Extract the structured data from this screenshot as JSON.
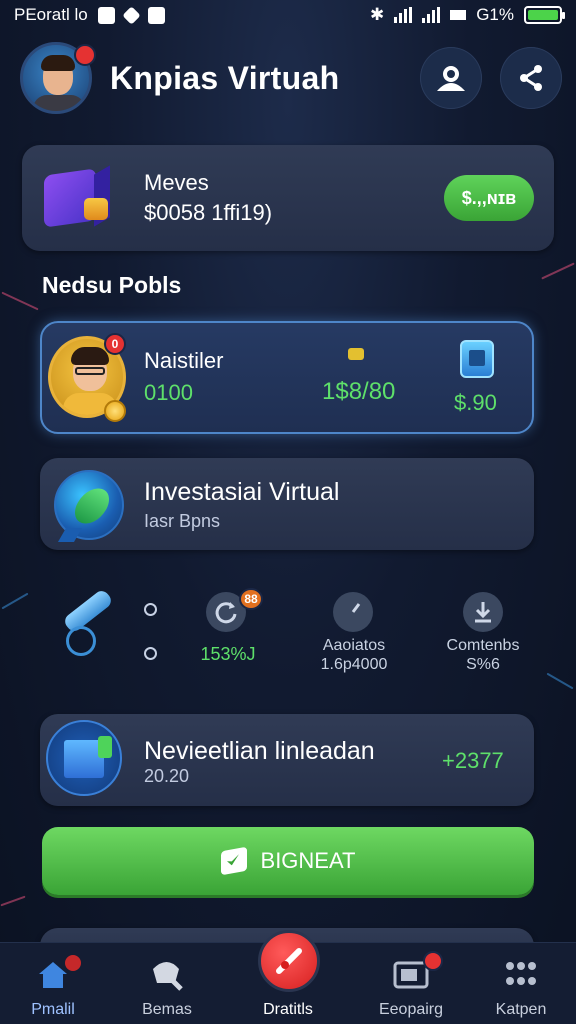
{
  "status_bar": {
    "carrier": "PEoratl lo",
    "battery": "G1%"
  },
  "header": {
    "title": "Knpias Virtuah",
    "avatar_badge": "",
    "actions": [
      {
        "icon": "profile-search-icon"
      },
      {
        "icon": "share-icon"
      }
    ]
  },
  "movies_card": {
    "title": "Meves",
    "value": "$0058 1ffi19)",
    "button_label": "$.,,ɴɪʙ"
  },
  "section": {
    "title": "Nedsu Pobls"
  },
  "player_card": {
    "name": "Naistiler",
    "score": "0100",
    "amount": "1$8/80",
    "price": "$.90",
    "avatar_badge": "0"
  },
  "invest_card": {
    "title": "Investasiai Virtual",
    "subtitle": "Iasr Bpns"
  },
  "stats": [
    {
      "icon": "refresh-icon",
      "value": "153%J",
      "badge": "88",
      "label": ""
    },
    {
      "icon": "compass-icon",
      "label_line1": "Aaoiatos",
      "label_line2": "1.6p4000"
    },
    {
      "icon": "download-icon",
      "label_line1": "Comtenbs",
      "label_line2": "S%6"
    }
  ],
  "news_card": {
    "title": "Nevieetlian linleadan",
    "subtitle": "20.20",
    "value": "+2377"
  },
  "cta": {
    "label": "BIGNEAT"
  },
  "nav": [
    {
      "label": "Pmalil",
      "icon": "home-icon"
    },
    {
      "label": "Bemas",
      "icon": "games-icon"
    },
    {
      "label": "Dratitls",
      "icon": "create-icon"
    },
    {
      "label": "Eeopairg",
      "icon": "wallet-icon"
    },
    {
      "label": "Katpen",
      "icon": "grid-icon"
    }
  ],
  "colors": {
    "accent_green": "#4cc441",
    "accent_red": "#e53232",
    "highlight_blue": "#4e86c9",
    "bg": "#111a30"
  }
}
